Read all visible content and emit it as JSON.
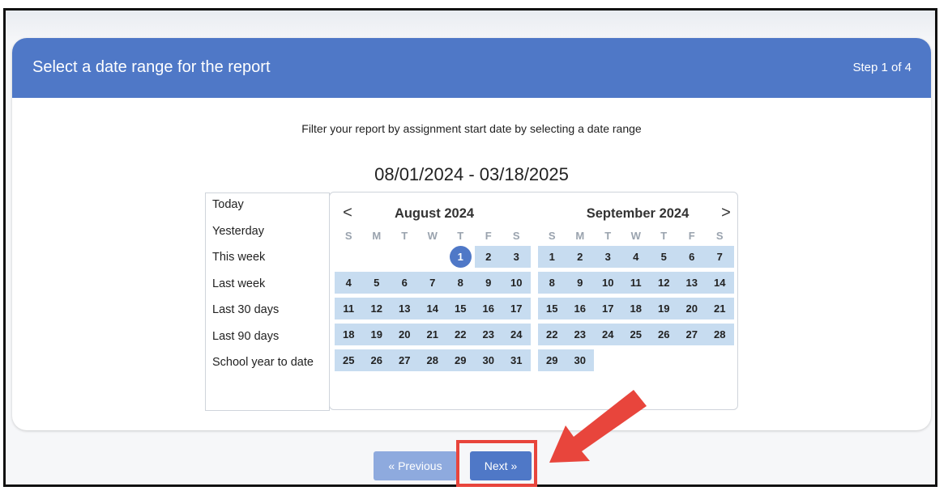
{
  "card": {
    "title": "Select a date range for the report",
    "step": "Step 1 of 4",
    "instruction": "Filter your report by assignment start date by selecting a date range",
    "range_display": "08/01/2024 - 03/18/2025"
  },
  "presets": [
    "Today",
    "Yesterday",
    "This week",
    "Last week",
    "Last 30 days",
    "Last 90 days",
    "School year to date"
  ],
  "calendar": {
    "prev_icon": "chevron-left-icon",
    "next_icon": "chevron-right-icon",
    "prev_glyph": "<",
    "next_glyph": ">",
    "weekdays": [
      "S",
      "M",
      "T",
      "W",
      "T",
      "F",
      "S"
    ],
    "selected_start": "1",
    "months": [
      {
        "title": "August 2024",
        "weeks": [
          [
            "",
            "",
            "",
            "",
            "1",
            "2",
            "3"
          ],
          [
            "4",
            "5",
            "6",
            "7",
            "8",
            "9",
            "10"
          ],
          [
            "11",
            "12",
            "13",
            "14",
            "15",
            "16",
            "17"
          ],
          [
            "18",
            "19",
            "20",
            "21",
            "22",
            "23",
            "24"
          ],
          [
            "25",
            "26",
            "27",
            "28",
            "29",
            "30",
            "31"
          ]
        ]
      },
      {
        "title": "September 2024",
        "weeks": [
          [
            "1",
            "2",
            "3",
            "4",
            "5",
            "6",
            "7"
          ],
          [
            "8",
            "9",
            "10",
            "11",
            "12",
            "13",
            "14"
          ],
          [
            "15",
            "16",
            "17",
            "18",
            "19",
            "20",
            "21"
          ],
          [
            "22",
            "23",
            "24",
            "25",
            "26",
            "27",
            "28"
          ],
          [
            "29",
            "30",
            "",
            "",
            "",
            "",
            ""
          ]
        ]
      }
    ]
  },
  "buttons": {
    "previous": "« Previous",
    "next": "Next »"
  },
  "colors": {
    "header": "#4f78c7",
    "range_fill": "#c7dcf0",
    "annotation": "#e8453c"
  }
}
